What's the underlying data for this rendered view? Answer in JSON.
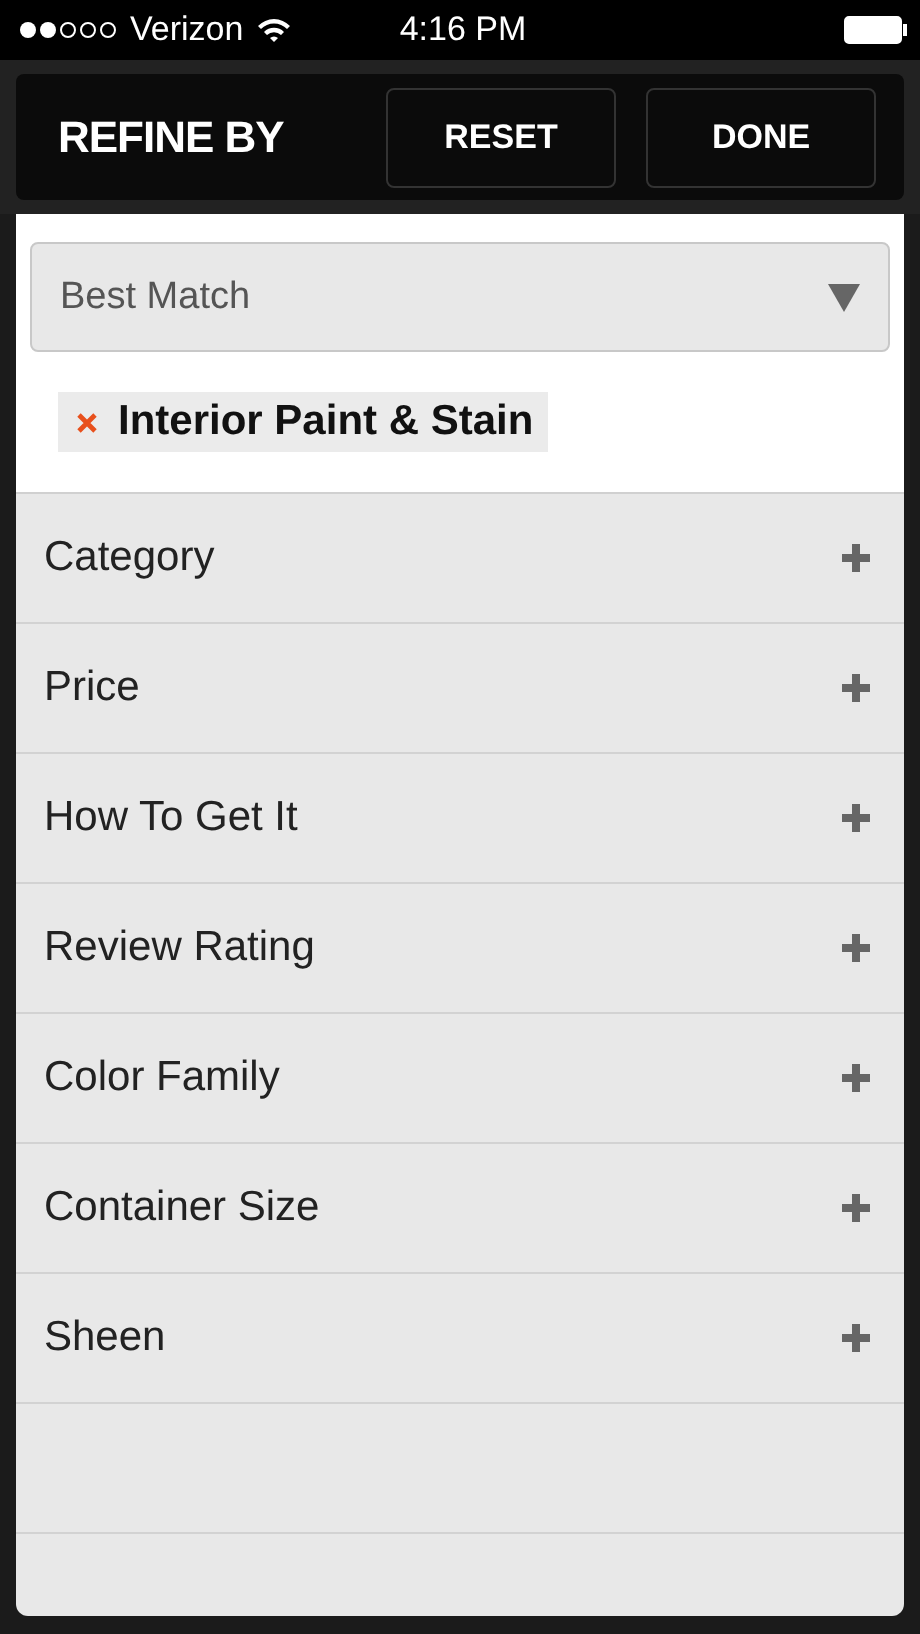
{
  "status_bar": {
    "carrier": "Verizon",
    "time": "4:16 PM"
  },
  "header": {
    "title": "REFINE BY",
    "buttons": [
      "RESET",
      "DONE"
    ]
  },
  "sort": {
    "value": "Best Match"
  },
  "applied_filters": [
    {
      "label": "Interior Paint & Stain"
    }
  ],
  "filters": [
    {
      "label": "Category",
      "expanded": false
    },
    {
      "label": "Price",
      "expanded": false
    },
    {
      "label": "How To Get It",
      "expanded": false
    },
    {
      "label": "Review Rating",
      "expanded": false
    },
    {
      "label": "Color Family",
      "expanded": false
    },
    {
      "label": "Container Size",
      "expanded": false
    },
    {
      "label": "Sheen",
      "expanded": false
    }
  ]
}
